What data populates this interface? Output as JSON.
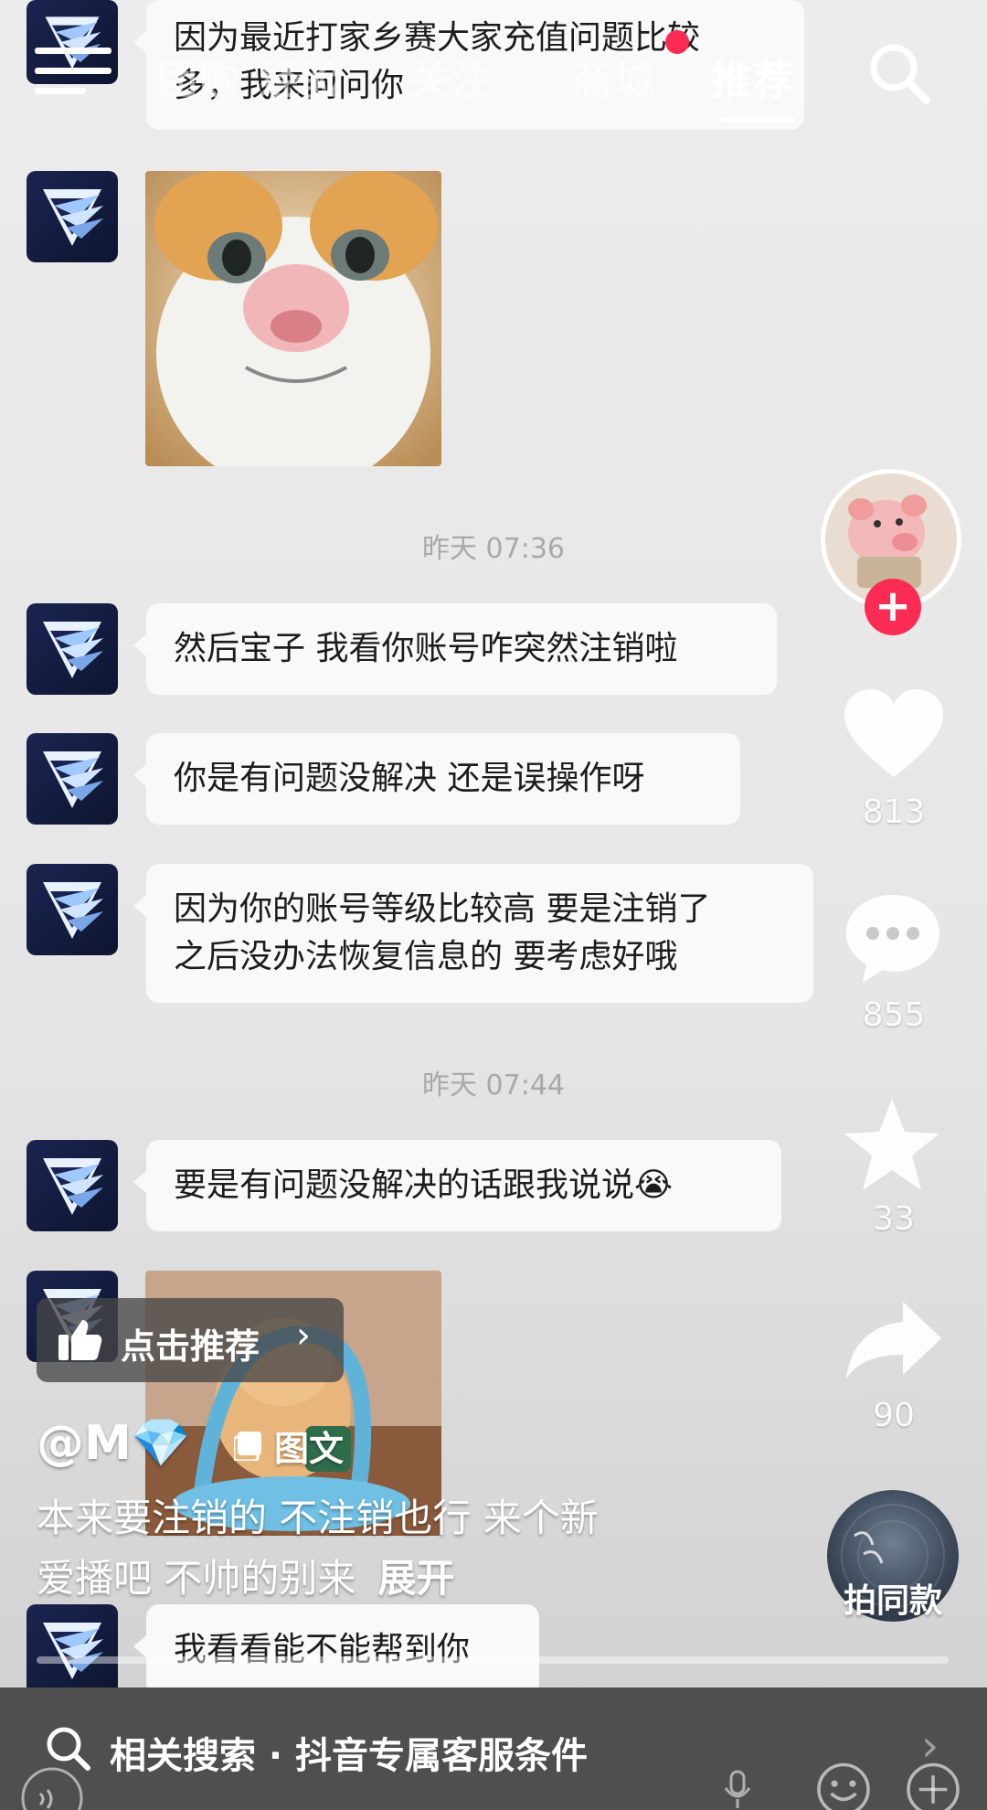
{
  "top_nav": {
    "tabs": [
      "团购",
      "经验",
      "关注",
      "商城",
      "推荐"
    ],
    "active_tab": "推荐"
  },
  "chat": {
    "messages": [
      {
        "type": "text",
        "lines": [
          "因为最近打家乡赛大家充值问题比较",
          "多，我来问问你"
        ]
      },
      {
        "type": "image",
        "alt": "cat-photo"
      },
      {
        "type": "time",
        "text": "昨天 07:36"
      },
      {
        "type": "text",
        "lines": [
          "然后宝子 我看你账号咋突然注销啦"
        ]
      },
      {
        "type": "text",
        "lines": [
          "你是有问题没解决 还是误操作呀"
        ]
      },
      {
        "type": "text",
        "lines": [
          "因为你的账号等级比较高 要是注销了",
          "之后没办法恢复信息的 要考虑好哦"
        ]
      },
      {
        "type": "time",
        "text": "昨天 07:44"
      },
      {
        "type": "text",
        "lines": [
          "要是有问题没解决的话跟我说说😭"
        ]
      },
      {
        "type": "image",
        "alt": "toy-bear-photo"
      },
      {
        "type": "text",
        "lines": [
          "我看看能不能帮到你"
        ]
      }
    ]
  },
  "actions": {
    "like_count": "813",
    "comment_count": "855",
    "favorite_count": "33",
    "share_count": "90",
    "follow_symbol": "+"
  },
  "recommend_button": {
    "label": "点击推荐"
  },
  "post": {
    "author": "@M💎",
    "type_label": "图文",
    "description_line1": "本来要注销的 不注销也行 来个新",
    "description_line2_text": "爱播吧 不帅的别来",
    "expand_label": "展开"
  },
  "music": {
    "label": "拍同款"
  },
  "bottom_bar": {
    "related_search_label": "相关搜索 · 抖音专属客服条件"
  },
  "colors": {
    "follow_badge": "#fe2c55",
    "live_dot": "#fe2c55",
    "bubble": "#f9f9f9",
    "bottom_bar": "#4f4f4f"
  }
}
